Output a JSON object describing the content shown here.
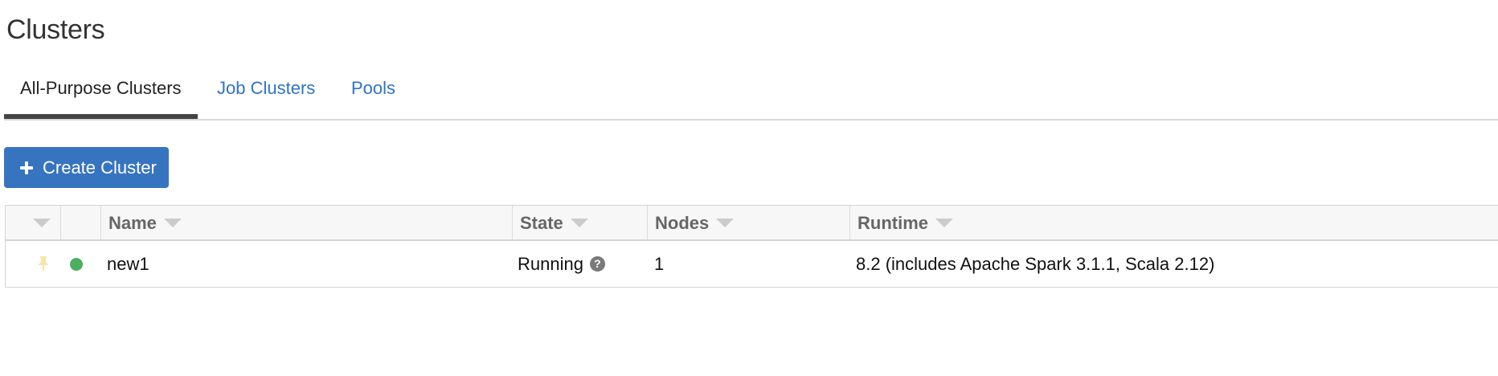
{
  "page": {
    "title": "Clusters"
  },
  "tabs": [
    {
      "label": "All-Purpose Clusters",
      "active": true
    },
    {
      "label": "Job Clusters",
      "active": false
    },
    {
      "label": "Pools",
      "active": false
    }
  ],
  "toolbar": {
    "create_label": "Create Cluster",
    "create_icon": "plus-icon"
  },
  "table": {
    "columns": [
      "",
      "",
      "Name",
      "State",
      "Nodes",
      "Runtime"
    ],
    "rows": [
      {
        "pinned_icon": "pin-icon",
        "status_color": "#4caf5f",
        "name": "new1",
        "state": "Running",
        "state_help": "?",
        "nodes": "1",
        "runtime": "8.2 (includes Apache Spark 3.1.1, Scala 2.12)"
      }
    ]
  },
  "colors": {
    "accent": "#3774c0",
    "link": "#2f73c6",
    "running": "#4caf5f"
  }
}
